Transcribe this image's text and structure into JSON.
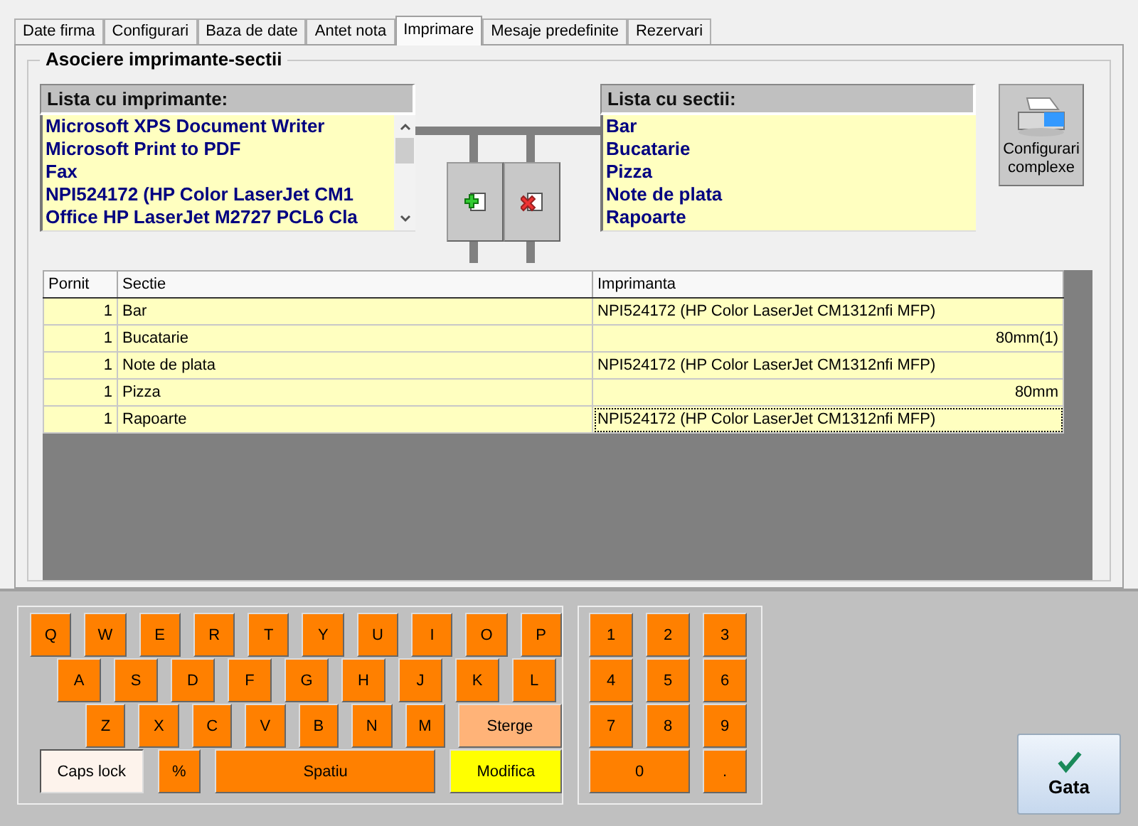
{
  "tabs": [
    {
      "label": "Date firma",
      "selected": false
    },
    {
      "label": "Configurari",
      "selected": false
    },
    {
      "label": "Baza de date",
      "selected": false
    },
    {
      "label": "Antet nota",
      "selected": false
    },
    {
      "label": "Imprimare",
      "selected": true
    },
    {
      "label": "Mesaje predefinite",
      "selected": false
    },
    {
      "label": "Rezervari",
      "selected": false
    }
  ],
  "group_title": "Asociere imprimante-sectii",
  "printer_list": {
    "header": "Lista cu imprimante:",
    "items": [
      "Microsoft XPS Document Writer",
      "Microsoft Print to PDF",
      "Fax",
      "NPI524172 (HP Color LaserJet CM1",
      "Office HP LaserJet M2727 PCL6 Cla"
    ]
  },
  "section_list": {
    "header": "Lista cu sectii:",
    "items": [
      "Bar",
      "Bucatarie",
      "Pizza",
      "Note de plata",
      "Rapoarte"
    ]
  },
  "complex_button": "Configurari complexe",
  "table": {
    "columns": [
      "Pornit",
      "Sectie",
      "Imprimanta"
    ],
    "rows": [
      {
        "pornit": "1",
        "sectie": "Bar",
        "imprimanta": "NPI524172 (HP Color LaserJet CM1312nfi MFP)",
        "kind": "printer",
        "focused": false
      },
      {
        "pornit": "1",
        "sectie": "Bucatarie",
        "imprimanta": "80mm(1)",
        "kind": "paper",
        "focused": false
      },
      {
        "pornit": "1",
        "sectie": "Note de plata",
        "imprimanta": "NPI524172 (HP Color LaserJet CM1312nfi MFP)",
        "kind": "printer",
        "focused": false
      },
      {
        "pornit": "1",
        "sectie": "Pizza",
        "imprimanta": "80mm",
        "kind": "paper",
        "focused": false
      },
      {
        "pornit": "1",
        "sectie": "Rapoarte",
        "imprimanta": "NPI524172 (HP Color LaserJet CM1312nfi MFP)",
        "kind": "printer",
        "focused": true
      }
    ]
  },
  "keyboard": [
    [
      {
        "label": "Q",
        "kind": "key"
      },
      {
        "label": "W",
        "kind": "key"
      },
      {
        "label": "E",
        "kind": "key"
      },
      {
        "label": "R",
        "kind": "key"
      },
      {
        "label": "T",
        "kind": "key"
      },
      {
        "label": "Y",
        "kind": "key"
      },
      {
        "label": "U",
        "kind": "key"
      },
      {
        "label": "I",
        "kind": "key"
      },
      {
        "label": "O",
        "kind": "key"
      },
      {
        "label": "P",
        "kind": "key"
      }
    ],
    [
      {
        "label": "A",
        "kind": "key"
      },
      {
        "label": "S",
        "kind": "key"
      },
      {
        "label": "D",
        "kind": "key"
      },
      {
        "label": "F",
        "kind": "key"
      },
      {
        "label": "G",
        "kind": "key"
      },
      {
        "label": "H",
        "kind": "key"
      },
      {
        "label": "J",
        "kind": "key"
      },
      {
        "label": "K",
        "kind": "key"
      },
      {
        "label": "L",
        "kind": "key"
      }
    ],
    [
      {
        "label": "Z",
        "kind": "key"
      },
      {
        "label": "X",
        "kind": "key"
      },
      {
        "label": "C",
        "kind": "key"
      },
      {
        "label": "V",
        "kind": "key"
      },
      {
        "label": "B",
        "kind": "key"
      },
      {
        "label": "N",
        "kind": "key"
      },
      {
        "label": "M",
        "kind": "key"
      },
      {
        "label": "Sterge",
        "kind": "delete"
      }
    ],
    [
      {
        "label": "Caps lock",
        "kind": "toggle"
      },
      {
        "label": "%",
        "kind": "key"
      },
      {
        "label": "Spatiu",
        "kind": "space"
      },
      {
        "label": "Modifica",
        "kind": "modify"
      }
    ]
  ],
  "numpad": [
    {
      "label": "1",
      "kind": "key"
    },
    {
      "label": "2",
      "kind": "key"
    },
    {
      "label": "3",
      "kind": "key"
    },
    {
      "label": "4",
      "kind": "key"
    },
    {
      "label": "5",
      "kind": "key"
    },
    {
      "label": "6",
      "kind": "key"
    },
    {
      "label": "7",
      "kind": "key"
    },
    {
      "label": "8",
      "kind": "key"
    },
    {
      "label": "9",
      "kind": "key"
    },
    {
      "label": "0",
      "kind": "wide"
    },
    {
      "label": ".",
      "kind": "key"
    }
  ],
  "done_button": "Gata"
}
